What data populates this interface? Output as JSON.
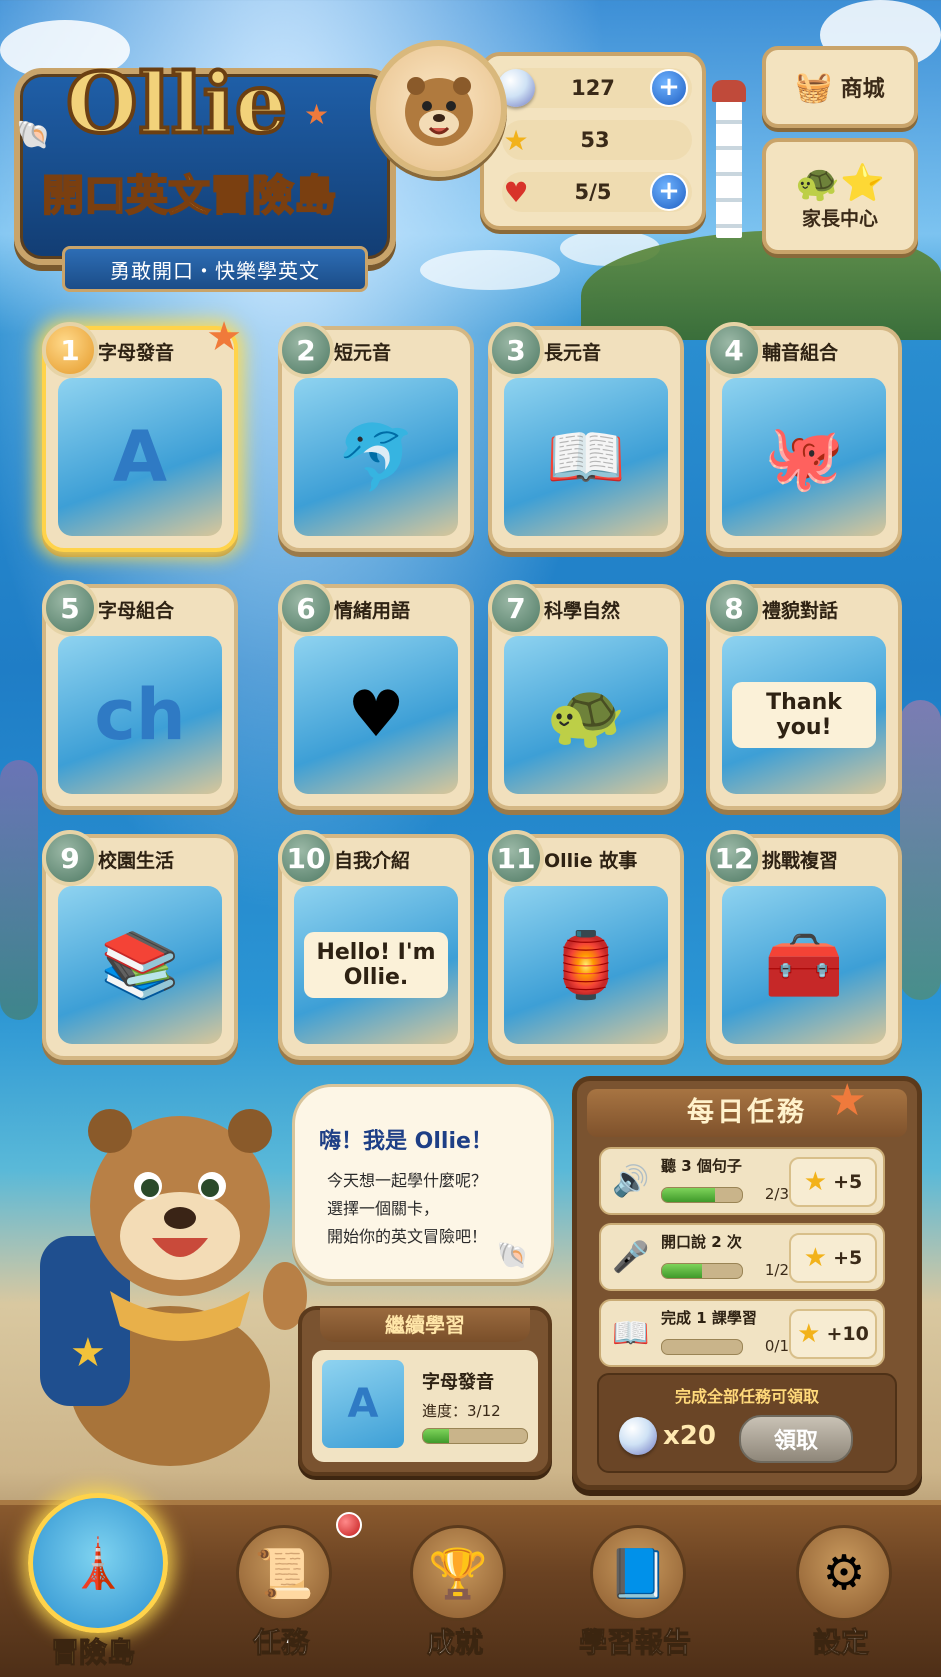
{
  "logo": {
    "title": "Ollie",
    "subtitle": "開口英文冒險島",
    "ribbon": "勇敢開口・快樂學英文"
  },
  "stats": {
    "pearls": "127",
    "stars": "53",
    "hearts": "5/5"
  },
  "side_buttons": {
    "shop": "商城",
    "parents": "家長中心"
  },
  "levels": [
    {
      "num": "1",
      "title": "字母發音",
      "icon": "A",
      "active": true
    },
    {
      "num": "2",
      "title": "短元音",
      "icon": "🐬"
    },
    {
      "num": "3",
      "title": "長元音",
      "icon": "📖"
    },
    {
      "num": "4",
      "title": "輔音組合",
      "icon": "🐙"
    },
    {
      "num": "5",
      "title": "字母組合",
      "icon": "ch"
    },
    {
      "num": "6",
      "title": "情緒用語",
      "icon": "♥"
    },
    {
      "num": "7",
      "title": "科學自然",
      "icon": "🐢"
    },
    {
      "num": "8",
      "title": "禮貌對話",
      "icon": "Thank you!"
    },
    {
      "num": "9",
      "title": "校園生活",
      "icon": "📚"
    },
    {
      "num": "10",
      "title": "自我介紹",
      "icon": "Hello! I'm Ollie."
    },
    {
      "num": "11",
      "title": "Ollie 故事",
      "icon": "🏮"
    },
    {
      "num": "12",
      "title": "挑戰複習",
      "icon": "🧰"
    }
  ],
  "speech": {
    "title": "嗨！我是 Ollie！",
    "line1": "今天想一起學什麼呢？",
    "line2": "選擇一個關卡，",
    "line3": "開始你的英文冒險吧！"
  },
  "continue": {
    "header": "繼續學習",
    "name": "字母發音",
    "progress": "進度：3/12",
    "progress_value": 0.25
  },
  "daily": {
    "title": "每日任務",
    "tasks": [
      {
        "label": "聽 3 個句子",
        "count": "2/3",
        "reward": "+5",
        "fill": 0.667
      },
      {
        "label": "開口說 2 次",
        "count": "1/2",
        "reward": "+5",
        "fill": 0.5
      },
      {
        "label": "完成 1 課學習",
        "count": "0/1",
        "reward": "+10",
        "fill": 0
      }
    ],
    "footer_title": "完成全部任務可領取",
    "footer_reward": "x20",
    "claim_label": "領取"
  },
  "nav": [
    {
      "label": "冒險島",
      "icon": "lighthouse-icon",
      "active": true
    },
    {
      "label": "任務",
      "icon": "map-scroll-icon"
    },
    {
      "label": "成就",
      "icon": "trophy-icon"
    },
    {
      "label": "學習報告",
      "icon": "book-icon"
    },
    {
      "label": "設定",
      "icon": "gear-icon"
    }
  ],
  "colors": {
    "accent_gold": "#ffd34a",
    "wood": "#7a5330",
    "panel": "#f1e0bd",
    "plus_blue": "#1f5fc2"
  }
}
